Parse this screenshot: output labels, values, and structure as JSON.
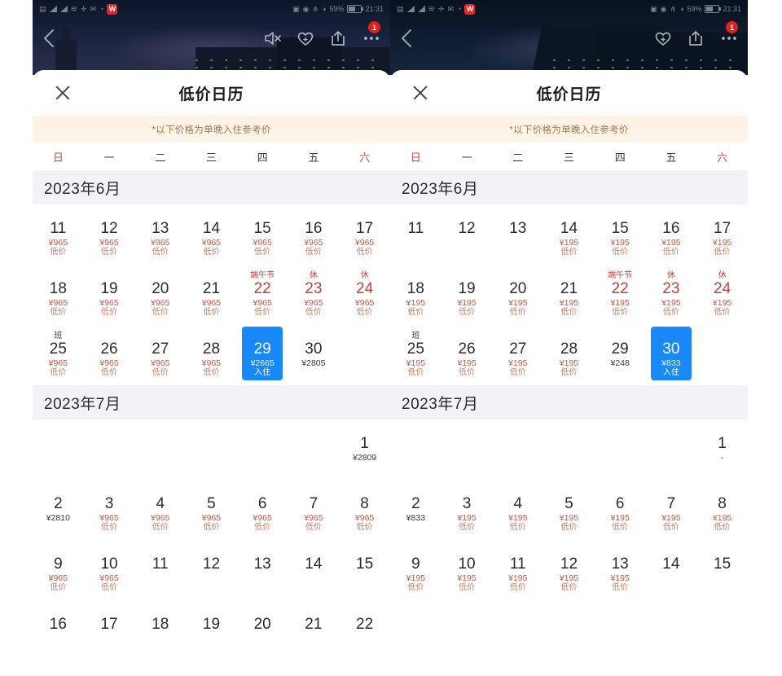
{
  "statusbar": {
    "wechat_icon": "W",
    "battery_percent": "59%",
    "time": "21:31",
    "signal_icon": "signal-icon",
    "wifi_icon": "wifi-icon"
  },
  "nav": {
    "back_icon": "chevron-left-icon",
    "mute_icon": "speaker-mute-icon",
    "favorite_icon": "heart-plus-icon",
    "share_icon": "share-icon",
    "more_icon": "more-dots-icon",
    "badge_count": "1"
  },
  "sheet": {
    "close_icon": "close-icon",
    "title": "低价日历",
    "notice": "*以下价格为单晚入住参考价",
    "weekdays": [
      "日",
      "一",
      "二",
      "三",
      "四",
      "五",
      "六"
    ],
    "low_label": "低价",
    "checkin_label": "入住",
    "dash": "-"
  },
  "accent": {
    "selected_blue": "#1989fa",
    "price_red": "#c25b4e",
    "holiday_red": "#c4403a",
    "notice_bg": "#fdf1e3",
    "notice_text": "#a9784a",
    "month_bar_bg": "#f1f3f6"
  },
  "panels": [
    {
      "id": "left",
      "has_mute_icon": true,
      "months": [
        {
          "title": "2023年6月",
          "lead_blanks": 0,
          "days": [
            {
              "n": "11",
              "price": "¥965",
              "low": true
            },
            {
              "n": "12",
              "price": "¥965",
              "low": true
            },
            {
              "n": "13",
              "price": "¥965",
              "low": true
            },
            {
              "n": "14",
              "price": "¥965",
              "low": true
            },
            {
              "n": "15",
              "price": "¥965",
              "low": true
            },
            {
              "n": "16",
              "price": "¥965",
              "low": true
            },
            {
              "n": "17",
              "price": "¥965",
              "low": true
            },
            {
              "n": "18",
              "price": "¥965",
              "low": true
            },
            {
              "n": "19",
              "price": "¥965",
              "low": true
            },
            {
              "n": "20",
              "price": "¥965",
              "low": true
            },
            {
              "n": "21",
              "price": "¥965",
              "low": true
            },
            {
              "n": "22",
              "price": "¥965",
              "low": true,
              "tag": "端午节",
              "holiday": true
            },
            {
              "n": "23",
              "price": "¥965",
              "low": true,
              "tag": "休",
              "holiday": true
            },
            {
              "n": "24",
              "price": "¥965",
              "low": true,
              "tag": "休",
              "holiday": true
            },
            {
              "n": "25",
              "price": "¥965",
              "low": true,
              "tag": "班",
              "work": true
            },
            {
              "n": "26",
              "price": "¥965",
              "low": true
            },
            {
              "n": "27",
              "price": "¥965",
              "low": true
            },
            {
              "n": "28",
              "price": "¥965",
              "low": true
            },
            {
              "n": "29",
              "price": "¥2665",
              "selected": true,
              "checkin": true
            },
            {
              "n": "30",
              "price": "¥2805",
              "plain": true
            }
          ]
        },
        {
          "title": "2023年7月",
          "lead_blanks": 6,
          "days": [
            {
              "n": "1",
              "price": "¥2809",
              "plain": true
            },
            {
              "n": "2",
              "price": "¥2810",
              "plain": true
            },
            {
              "n": "3",
              "price": "¥965",
              "low": true
            },
            {
              "n": "4",
              "price": "¥965",
              "low": true
            },
            {
              "n": "5",
              "price": "¥965",
              "low": true
            },
            {
              "n": "6",
              "price": "¥965",
              "low": true
            },
            {
              "n": "7",
              "price": "¥965",
              "low": true
            },
            {
              "n": "8",
              "price": "¥965",
              "low": true
            },
            {
              "n": "9",
              "price": "¥965",
              "low": true
            },
            {
              "n": "10",
              "price": "¥965",
              "low": true
            },
            {
              "n": "11"
            },
            {
              "n": "12"
            },
            {
              "n": "13"
            },
            {
              "n": "14"
            },
            {
              "n": "15"
            },
            {
              "n": "16"
            },
            {
              "n": "17"
            },
            {
              "n": "18"
            },
            {
              "n": "19"
            },
            {
              "n": "20"
            },
            {
              "n": "21"
            },
            {
              "n": "22"
            }
          ]
        }
      ]
    },
    {
      "id": "right",
      "has_mute_icon": false,
      "months": [
        {
          "title": "2023年6月",
          "lead_blanks": 0,
          "days": [
            {
              "n": "11"
            },
            {
              "n": "12"
            },
            {
              "n": "13"
            },
            {
              "n": "14",
              "price": "¥195",
              "low": true
            },
            {
              "n": "15",
              "price": "¥195",
              "low": true
            },
            {
              "n": "16",
              "price": "¥195",
              "low": true
            },
            {
              "n": "17",
              "price": "¥195",
              "low": true
            },
            {
              "n": "18",
              "price": "¥195",
              "low": true
            },
            {
              "n": "19",
              "price": "¥195",
              "low": true
            },
            {
              "n": "20",
              "price": "¥195",
              "low": true
            },
            {
              "n": "21",
              "price": "¥195",
              "low": true
            },
            {
              "n": "22",
              "price": "¥195",
              "low": true,
              "tag": "端午节",
              "holiday": true
            },
            {
              "n": "23",
              "price": "¥195",
              "low": true,
              "tag": "休",
              "holiday": true
            },
            {
              "n": "24",
              "price": "¥195",
              "low": true,
              "tag": "休",
              "holiday": true
            },
            {
              "n": "25",
              "price": "¥195",
              "low": true,
              "tag": "班",
              "work": true
            },
            {
              "n": "26",
              "price": "¥195",
              "low": true
            },
            {
              "n": "27",
              "price": "¥195",
              "low": true
            },
            {
              "n": "28",
              "price": "¥195",
              "low": true
            },
            {
              "n": "29",
              "price": "¥248",
              "plain": true
            },
            {
              "n": "30",
              "price": "¥833",
              "selected": true,
              "checkin": true
            }
          ]
        },
        {
          "title": "2023年7月",
          "lead_blanks": 6,
          "days": [
            {
              "n": "1",
              "price": "-",
              "plain": true
            },
            {
              "n": "2",
              "price": "¥833",
              "plain": true
            },
            {
              "n": "3",
              "price": "¥195",
              "low": true
            },
            {
              "n": "4",
              "price": "¥195",
              "low": true
            },
            {
              "n": "5",
              "price": "¥195",
              "low": true
            },
            {
              "n": "6",
              "price": "¥195",
              "low": true
            },
            {
              "n": "7",
              "price": "¥195",
              "low": true
            },
            {
              "n": "8",
              "price": "¥195",
              "low": true
            },
            {
              "n": "9",
              "price": "¥195",
              "low": true
            },
            {
              "n": "10",
              "price": "¥195",
              "low": true
            },
            {
              "n": "11",
              "price": "¥195",
              "low": true
            },
            {
              "n": "12",
              "price": "¥195",
              "low": true
            },
            {
              "n": "13",
              "price": "¥195",
              "low": true
            },
            {
              "n": "14"
            },
            {
              "n": "15"
            }
          ]
        }
      ]
    }
  ]
}
